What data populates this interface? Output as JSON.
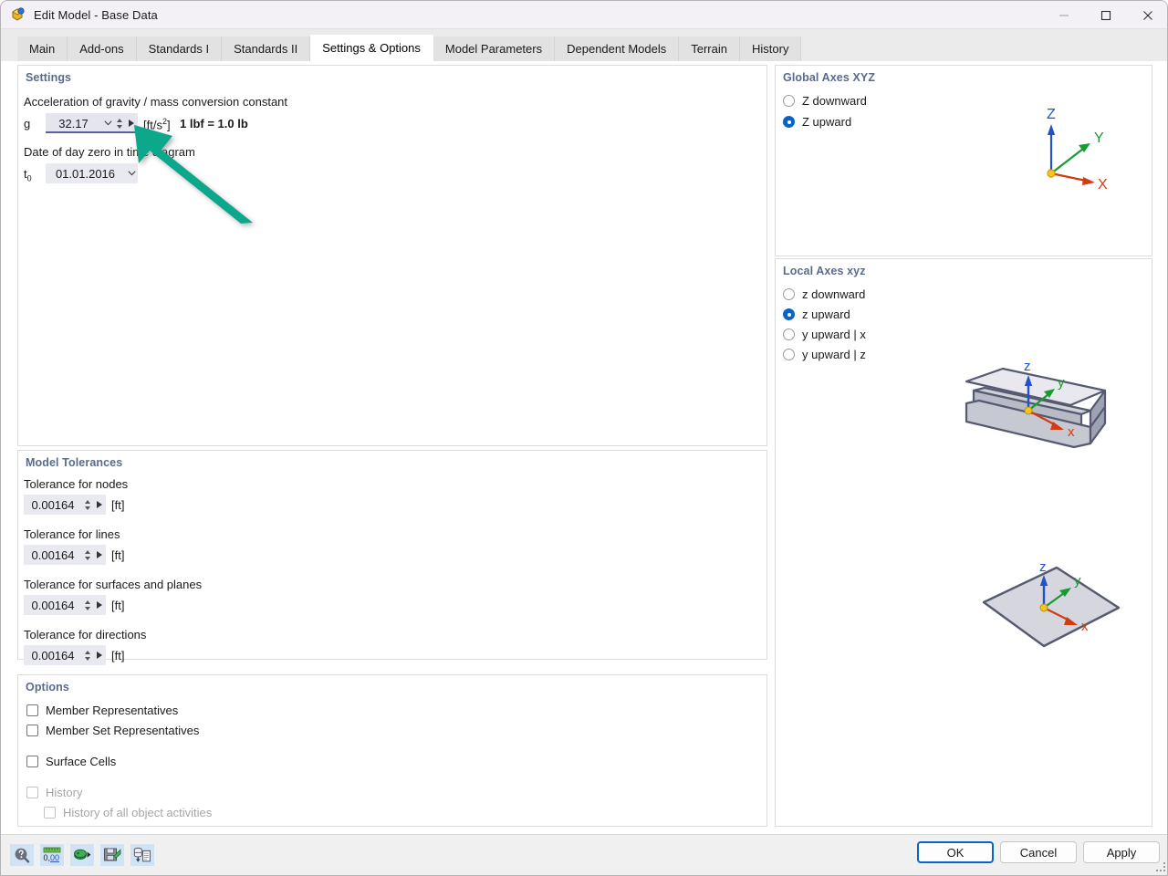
{
  "window": {
    "title": "Edit Model - Base Data",
    "icon": "model-icon",
    "controls": {
      "minimize": "minimize-icon",
      "maximize": "maximize-icon",
      "close": "close-icon"
    }
  },
  "tabs": [
    {
      "label": "Main",
      "active": false
    },
    {
      "label": "Add-ons",
      "active": false
    },
    {
      "label": "Standards I",
      "active": false
    },
    {
      "label": "Standards II",
      "active": false
    },
    {
      "label": "Settings & Options",
      "active": true
    },
    {
      "label": "Model Parameters",
      "active": false
    },
    {
      "label": "Dependent Models",
      "active": false
    },
    {
      "label": "Terrain",
      "active": false
    },
    {
      "label": "History",
      "active": false
    }
  ],
  "settings": {
    "title": "Settings",
    "gravity_caption": "Acceleration of gravity / mass conversion constant",
    "gravity_symbol": "g",
    "gravity_value": "32.17",
    "gravity_unit_prefix": "[ft/s",
    "gravity_unit_sup": "2",
    "gravity_unit_suffix": "]",
    "conversion_note": "1 lbf = 1.0 lb",
    "date_caption": "Date of day zero in time diagram",
    "date_symbol_main": "t",
    "date_symbol_sub": "0",
    "date_value": "01.01.2016"
  },
  "tolerances": {
    "title": "Model Tolerances",
    "unit": "[ft]",
    "items": [
      {
        "label": "Tolerance for nodes",
        "value": "0.00164"
      },
      {
        "label": "Tolerance for lines",
        "value": "0.00164"
      },
      {
        "label": "Tolerance for surfaces and planes",
        "value": "0.00164"
      },
      {
        "label": "Tolerance for directions",
        "value": "0.00164"
      }
    ]
  },
  "options": {
    "title": "Options",
    "items": [
      {
        "label": "Member Representatives",
        "checked": false,
        "disabled": false,
        "indent": 0
      },
      {
        "label": "Member Set Representatives",
        "checked": false,
        "disabled": false,
        "indent": 0
      },
      {
        "label": "Surface Cells",
        "checked": false,
        "disabled": false,
        "indent": 0
      },
      {
        "label": "History",
        "checked": false,
        "disabled": true,
        "indent": 0
      },
      {
        "label": "History of all object activities",
        "checked": false,
        "disabled": true,
        "indent": 1
      }
    ]
  },
  "global_axes": {
    "title": "Global Axes XYZ",
    "options": [
      {
        "label": "Z downward",
        "selected": false
      },
      {
        "label": "Z upward",
        "selected": true
      }
    ],
    "diagram": {
      "name": "global-axes-diagram",
      "axis_z": "Z",
      "axis_y": "Y",
      "axis_x": "X"
    }
  },
  "local_axes": {
    "title": "Local Axes xyz",
    "options": [
      {
        "label": "z downward",
        "selected": false
      },
      {
        "label": "z upward",
        "selected": true
      },
      {
        "label": "y upward | x",
        "selected": false
      },
      {
        "label": "y upward | z",
        "selected": false
      }
    ],
    "beam_diagram": {
      "name": "i-beam-local-axes-diagram",
      "axis_z": "z",
      "axis_y": "y",
      "axis_x": "x"
    },
    "surface_diagram": {
      "name": "surface-local-axes-diagram",
      "axis_z": "z",
      "axis_y": "y",
      "axis_x": "x"
    }
  },
  "toolbar": [
    {
      "name": "help-icon"
    },
    {
      "name": "units-icon"
    },
    {
      "name": "export-icon"
    },
    {
      "name": "save-defaults-icon"
    },
    {
      "name": "copy-to-clipboard-icon"
    }
  ],
  "dialog_buttons": {
    "ok": "OK",
    "cancel": "Cancel",
    "apply": "Apply"
  },
  "annotation": {
    "name": "callout-arrow",
    "color": "#10a78b",
    "points_to": "gravity-value-field"
  },
  "colors": {
    "accent_blue": "#0a64c8",
    "panel_heading": "#5a6b8c",
    "field_bg": "#e9e9f0",
    "axis_z": "#2052c8",
    "axis_y": "#159b2f",
    "axis_x": "#d23c10",
    "origin": "#f5c518",
    "arrow_teal": "#10a78b"
  }
}
